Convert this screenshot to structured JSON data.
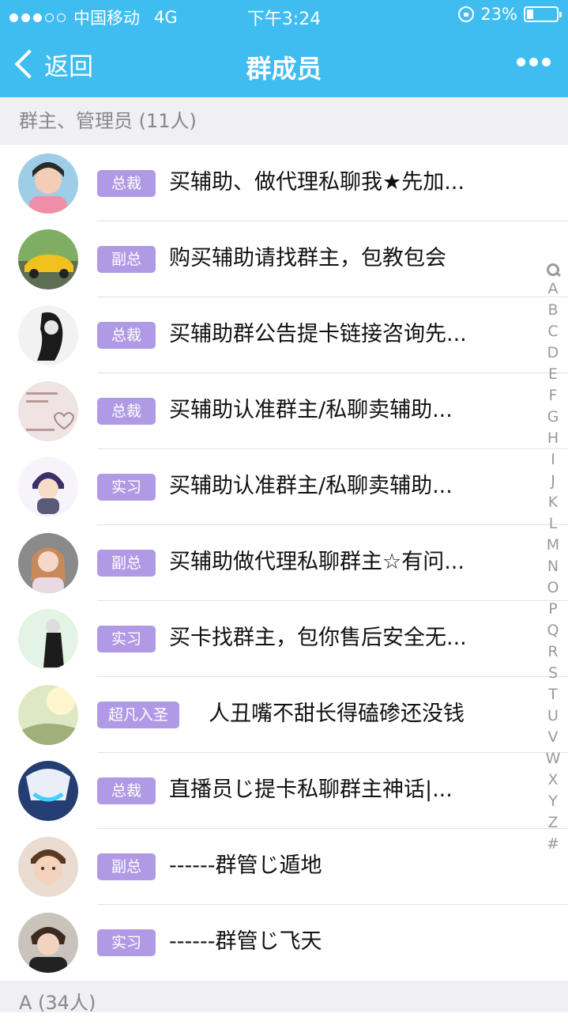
{
  "status_bar": {
    "carrier": "中国移动",
    "network": "4G",
    "time": "下午3:24",
    "battery": "23%",
    "battery_level": 0.23,
    "signal_strength": 3,
    "signal_max": 5,
    "icons": [
      "lock-rotation-icon",
      "battery-icon"
    ]
  },
  "nav": {
    "back_label": "返回",
    "title": "群成员",
    "more_icon": "more-dots-icon"
  },
  "sections": [
    {
      "title": "群主、管理员 (11人)"
    },
    {
      "title": "A (34人)"
    }
  ],
  "members": [
    {
      "role": "总裁",
      "name": "买辅助、做代理私聊我★先加..."
    },
    {
      "role": "副总",
      "name": "购买辅助请找群主，包教包会"
    },
    {
      "role": "总裁",
      "name": "买辅助群公告提卡链接咨询先..."
    },
    {
      "role": "总裁",
      "name": "买辅助认准群主/私聊卖辅助..."
    },
    {
      "role": "实习",
      "name": "买辅助认准群主/私聊卖辅助..."
    },
    {
      "role": "副总",
      "name": "买辅助做代理私聊群主☆有问..."
    },
    {
      "role": "实习",
      "name": "买卡找群主，包你售后安全无..."
    },
    {
      "role": "超凡入圣",
      "name": "人丑嘴不甜长得磕碜还没钱"
    },
    {
      "role": "总裁",
      "name": "直播员じ提卡私聊群主神话|..."
    },
    {
      "role": "副总",
      "name": "------群管じ遁地"
    },
    {
      "role": "实习",
      "name": "------群管じ飞天"
    }
  ],
  "index_bar": [
    "A",
    "B",
    "C",
    "D",
    "E",
    "F",
    "G",
    "H",
    "I",
    "J",
    "K",
    "L",
    "M",
    "N",
    "O",
    "P",
    "Q",
    "R",
    "S",
    "T",
    "U",
    "V",
    "W",
    "X",
    "Y",
    "Z",
    "#"
  ],
  "colors": {
    "header_bg": "#40bdf0",
    "badge_bg": "#b19ae5",
    "section_bg": "#efeff4"
  }
}
